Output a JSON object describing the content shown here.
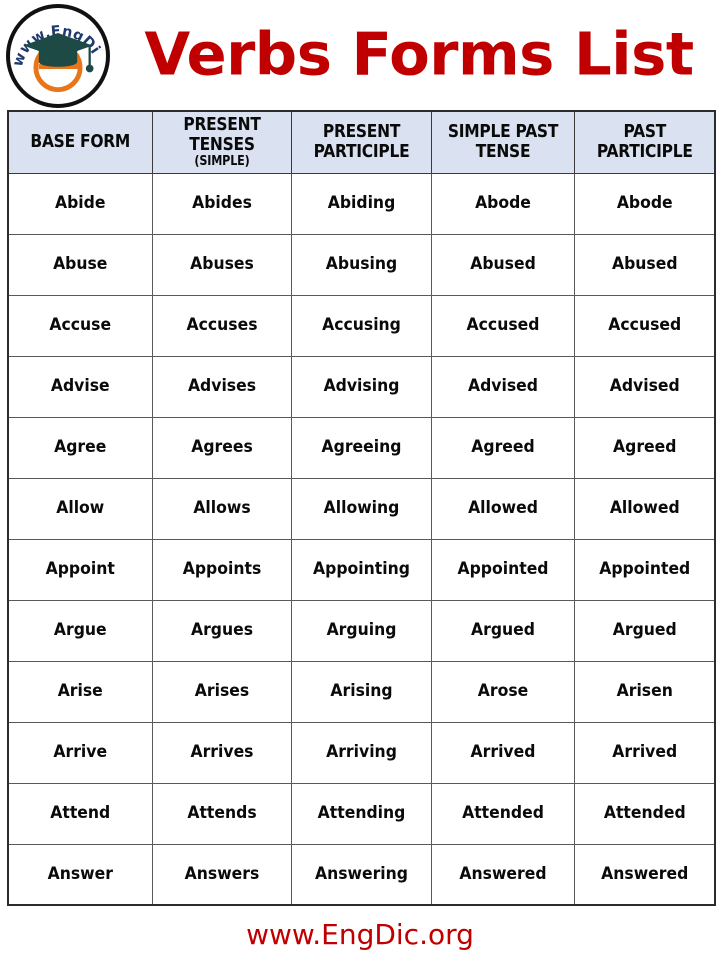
{
  "header": {
    "title": "Verbs Forms List",
    "title_color": "#c00000",
    "logo": {
      "name": "engdic-logo",
      "text": "www.EngDic.org",
      "ring_color": "#111111",
      "text_color": "#1f3a6e",
      "cap_color": "#1d4a45",
      "letter_color": "#e8751a",
      "letter": "e"
    }
  },
  "table": {
    "header_background": "#dae1f0",
    "columns": [
      {
        "id": "base-form",
        "label": "BASE FORM",
        "sub": ""
      },
      {
        "id": "present-tenses-simple",
        "label": "PRESENT TENSES",
        "sub": "(SIMPLE)"
      },
      {
        "id": "present-participle",
        "label": "PRESENT PARTICIPLE",
        "sub": ""
      },
      {
        "id": "simple-past-tense",
        "label": "SIMPLE PAST TENSE",
        "sub": ""
      },
      {
        "id": "past-participle",
        "label": "PAST PARTICIPLE",
        "sub": ""
      }
    ],
    "rows": [
      [
        "Abide",
        "Abides",
        "Abiding",
        "Abode",
        "Abode"
      ],
      [
        "Abuse",
        "Abuses",
        "Abusing",
        "Abused",
        "Abused"
      ],
      [
        "Accuse",
        "Accuses",
        "Accusing",
        "Accused",
        "Accused"
      ],
      [
        "Advise",
        "Advises",
        "Advising",
        "Advised",
        "Advised"
      ],
      [
        "Agree",
        "Agrees",
        "Agreeing",
        "Agreed",
        "Agreed"
      ],
      [
        "Allow",
        "Allows",
        "Allowing",
        "Allowed",
        "Allowed"
      ],
      [
        "Appoint",
        "Appoints",
        "Appointing",
        "Appointed",
        "Appointed"
      ],
      [
        "Argue",
        "Argues",
        "Arguing",
        "Argued",
        "Argued"
      ],
      [
        "Arise",
        "Arises",
        "Arising",
        "Arose",
        "Arisen"
      ],
      [
        "Arrive",
        "Arrives",
        "Arriving",
        "Arrived",
        "Arrived"
      ],
      [
        "Attend",
        "Attends",
        "Attending",
        "Attended",
        "Attended"
      ],
      [
        "Answer",
        "Answers",
        "Answering",
        "Answered",
        "Answered"
      ]
    ]
  },
  "footer": {
    "url": "www.EngDic.org",
    "url_color": "#c00000"
  }
}
